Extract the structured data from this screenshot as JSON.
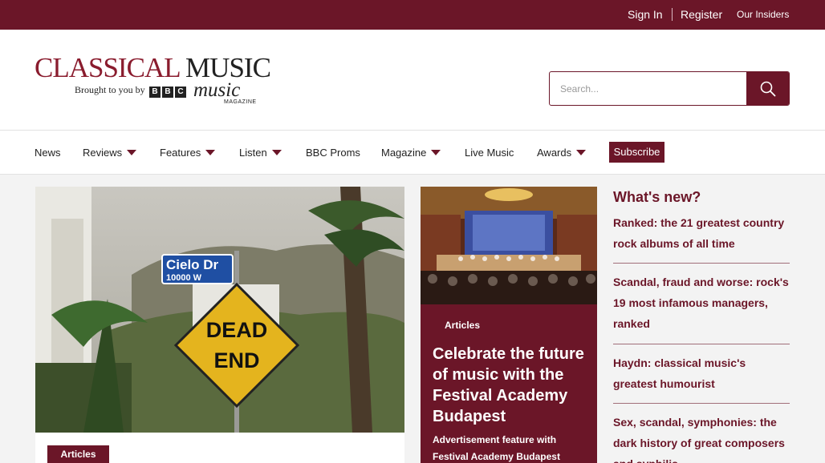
{
  "topbar": {
    "sign_in": "Sign In",
    "register": "Register",
    "insiders": "Our Insiders"
  },
  "logo": {
    "title_part1": "CLASSICAL",
    "title_part2": "MUSIC",
    "tagline": "Brought to you by",
    "bbc_letters": [
      "B",
      "B",
      "C"
    ],
    "music": "music",
    "magazine": "MAGAZINE"
  },
  "search": {
    "placeholder": "Search...",
    "icon": "search-icon"
  },
  "nav": {
    "items": [
      {
        "label": "News",
        "dropdown": false
      },
      {
        "label": "Reviews",
        "dropdown": true
      },
      {
        "label": "Features",
        "dropdown": true
      },
      {
        "label": "Listen",
        "dropdown": true
      },
      {
        "label": "BBC Proms",
        "dropdown": false
      },
      {
        "label": "Magazine",
        "dropdown": true
      },
      {
        "label": "Live Music",
        "dropdown": false
      },
      {
        "label": "Awards",
        "dropdown": true
      }
    ],
    "subscribe": "Subscribe"
  },
  "hero": {
    "image": "street-sign-cielo-dr-dead-end",
    "sign_street": "Cielo Dr",
    "sign_number": "10000 W",
    "sign_dead": "DEAD",
    "sign_end": "END",
    "badge": "Articles"
  },
  "feature": {
    "image": "concert-hall-orchestra",
    "tag": "Articles",
    "title": "Celebrate the future of music with the Festival Academy Budapest",
    "subtitle": "Advertisement feature with Festival Academy Budapest"
  },
  "whats_new": {
    "heading": "What's new?",
    "items": [
      "Ranked: the 21 greatest country rock albums of all time",
      "Scandal, fraud and worse: rock's 19 most infamous managers, ranked",
      "Haydn: classical music's greatest humourist",
      "Sex, scandal, symphonies: the dark history of great composers and syphilis"
    ]
  },
  "colors": {
    "brand": "#6b1628",
    "logo_red": "#8a1c2e"
  }
}
